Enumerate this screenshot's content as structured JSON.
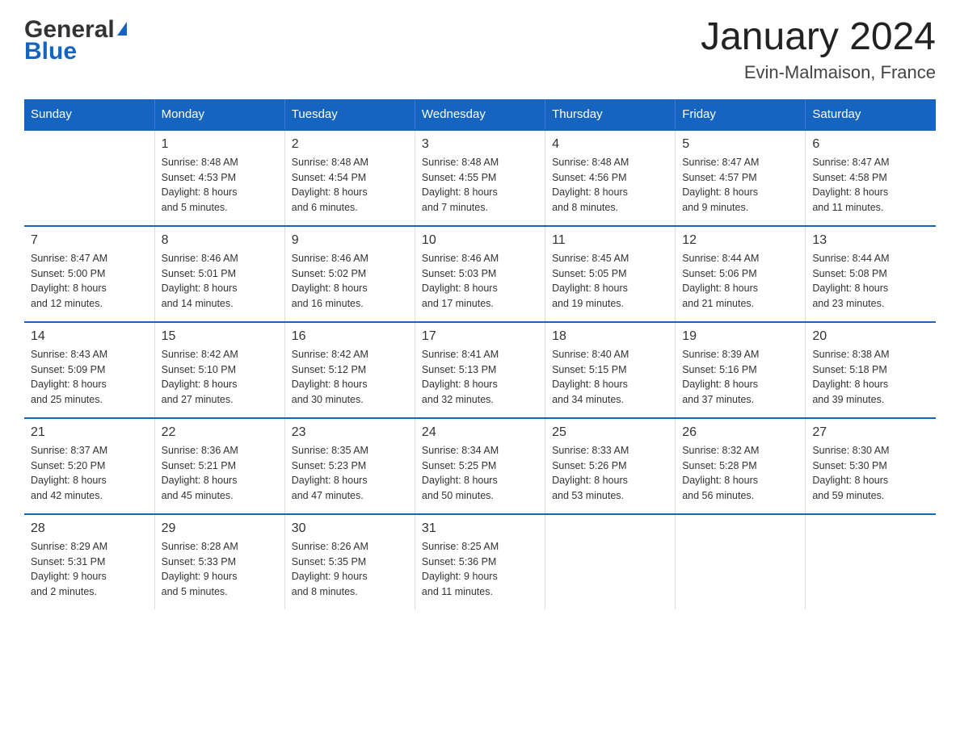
{
  "logo": {
    "general": "General",
    "blue": "Blue",
    "triangle_char": "▶"
  },
  "header": {
    "title": "January 2024",
    "subtitle": "Evin-Malmaison, France"
  },
  "weekdays": [
    "Sunday",
    "Monday",
    "Tuesday",
    "Wednesday",
    "Thursday",
    "Friday",
    "Saturday"
  ],
  "weeks": [
    [
      {
        "day": "",
        "info": ""
      },
      {
        "day": "1",
        "info": "Sunrise: 8:48 AM\nSunset: 4:53 PM\nDaylight: 8 hours\nand 5 minutes."
      },
      {
        "day": "2",
        "info": "Sunrise: 8:48 AM\nSunset: 4:54 PM\nDaylight: 8 hours\nand 6 minutes."
      },
      {
        "day": "3",
        "info": "Sunrise: 8:48 AM\nSunset: 4:55 PM\nDaylight: 8 hours\nand 7 minutes."
      },
      {
        "day": "4",
        "info": "Sunrise: 8:48 AM\nSunset: 4:56 PM\nDaylight: 8 hours\nand 8 minutes."
      },
      {
        "day": "5",
        "info": "Sunrise: 8:47 AM\nSunset: 4:57 PM\nDaylight: 8 hours\nand 9 minutes."
      },
      {
        "day": "6",
        "info": "Sunrise: 8:47 AM\nSunset: 4:58 PM\nDaylight: 8 hours\nand 11 minutes."
      }
    ],
    [
      {
        "day": "7",
        "info": "Sunrise: 8:47 AM\nSunset: 5:00 PM\nDaylight: 8 hours\nand 12 minutes."
      },
      {
        "day": "8",
        "info": "Sunrise: 8:46 AM\nSunset: 5:01 PM\nDaylight: 8 hours\nand 14 minutes."
      },
      {
        "day": "9",
        "info": "Sunrise: 8:46 AM\nSunset: 5:02 PM\nDaylight: 8 hours\nand 16 minutes."
      },
      {
        "day": "10",
        "info": "Sunrise: 8:46 AM\nSunset: 5:03 PM\nDaylight: 8 hours\nand 17 minutes."
      },
      {
        "day": "11",
        "info": "Sunrise: 8:45 AM\nSunset: 5:05 PM\nDaylight: 8 hours\nand 19 minutes."
      },
      {
        "day": "12",
        "info": "Sunrise: 8:44 AM\nSunset: 5:06 PM\nDaylight: 8 hours\nand 21 minutes."
      },
      {
        "day": "13",
        "info": "Sunrise: 8:44 AM\nSunset: 5:08 PM\nDaylight: 8 hours\nand 23 minutes."
      }
    ],
    [
      {
        "day": "14",
        "info": "Sunrise: 8:43 AM\nSunset: 5:09 PM\nDaylight: 8 hours\nand 25 minutes."
      },
      {
        "day": "15",
        "info": "Sunrise: 8:42 AM\nSunset: 5:10 PM\nDaylight: 8 hours\nand 27 minutes."
      },
      {
        "day": "16",
        "info": "Sunrise: 8:42 AM\nSunset: 5:12 PM\nDaylight: 8 hours\nand 30 minutes."
      },
      {
        "day": "17",
        "info": "Sunrise: 8:41 AM\nSunset: 5:13 PM\nDaylight: 8 hours\nand 32 minutes."
      },
      {
        "day": "18",
        "info": "Sunrise: 8:40 AM\nSunset: 5:15 PM\nDaylight: 8 hours\nand 34 minutes."
      },
      {
        "day": "19",
        "info": "Sunrise: 8:39 AM\nSunset: 5:16 PM\nDaylight: 8 hours\nand 37 minutes."
      },
      {
        "day": "20",
        "info": "Sunrise: 8:38 AM\nSunset: 5:18 PM\nDaylight: 8 hours\nand 39 minutes."
      }
    ],
    [
      {
        "day": "21",
        "info": "Sunrise: 8:37 AM\nSunset: 5:20 PM\nDaylight: 8 hours\nand 42 minutes."
      },
      {
        "day": "22",
        "info": "Sunrise: 8:36 AM\nSunset: 5:21 PM\nDaylight: 8 hours\nand 45 minutes."
      },
      {
        "day": "23",
        "info": "Sunrise: 8:35 AM\nSunset: 5:23 PM\nDaylight: 8 hours\nand 47 minutes."
      },
      {
        "day": "24",
        "info": "Sunrise: 8:34 AM\nSunset: 5:25 PM\nDaylight: 8 hours\nand 50 minutes."
      },
      {
        "day": "25",
        "info": "Sunrise: 8:33 AM\nSunset: 5:26 PM\nDaylight: 8 hours\nand 53 minutes."
      },
      {
        "day": "26",
        "info": "Sunrise: 8:32 AM\nSunset: 5:28 PM\nDaylight: 8 hours\nand 56 minutes."
      },
      {
        "day": "27",
        "info": "Sunrise: 8:30 AM\nSunset: 5:30 PM\nDaylight: 8 hours\nand 59 minutes."
      }
    ],
    [
      {
        "day": "28",
        "info": "Sunrise: 8:29 AM\nSunset: 5:31 PM\nDaylight: 9 hours\nand 2 minutes."
      },
      {
        "day": "29",
        "info": "Sunrise: 8:28 AM\nSunset: 5:33 PM\nDaylight: 9 hours\nand 5 minutes."
      },
      {
        "day": "30",
        "info": "Sunrise: 8:26 AM\nSunset: 5:35 PM\nDaylight: 9 hours\nand 8 minutes."
      },
      {
        "day": "31",
        "info": "Sunrise: 8:25 AM\nSunset: 5:36 PM\nDaylight: 9 hours\nand 11 minutes."
      },
      {
        "day": "",
        "info": ""
      },
      {
        "day": "",
        "info": ""
      },
      {
        "day": "",
        "info": ""
      }
    ]
  ]
}
